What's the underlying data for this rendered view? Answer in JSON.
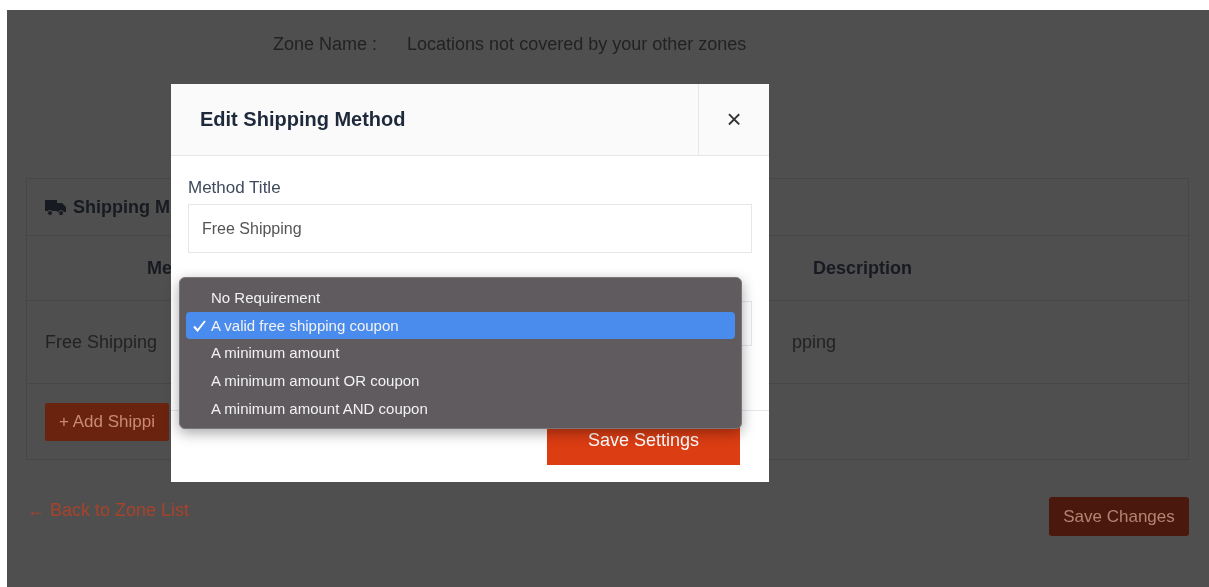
{
  "zone": {
    "label": "Zone Name :",
    "value": "Locations not covered by your other zones"
  },
  "methods_card": {
    "title": "Shipping M",
    "columns": [
      "Me",
      "Description"
    ],
    "rows": [
      {
        "cells": [
          "Free Shipping",
          "pping"
        ]
      }
    ],
    "add_button": "+ Add Shippi"
  },
  "back_link": "← Back to Zone List",
  "save_button": "Save Changes",
  "modal": {
    "title": "Edit Shipping Method",
    "close": "×",
    "fields": [
      {
        "label": "Method Title",
        "value": "Free Shipping"
      }
    ],
    "requirement_options": [
      {
        "label": "No Requirement",
        "selected": false
      },
      {
        "label": "A valid free shipping coupon",
        "selected": true
      },
      {
        "label": "A minimum amount",
        "selected": false
      },
      {
        "label": "A minimum amount OR coupon",
        "selected": false
      },
      {
        "label": "A minimum amount AND coupon",
        "selected": false
      }
    ],
    "submit": "Save Settings"
  }
}
